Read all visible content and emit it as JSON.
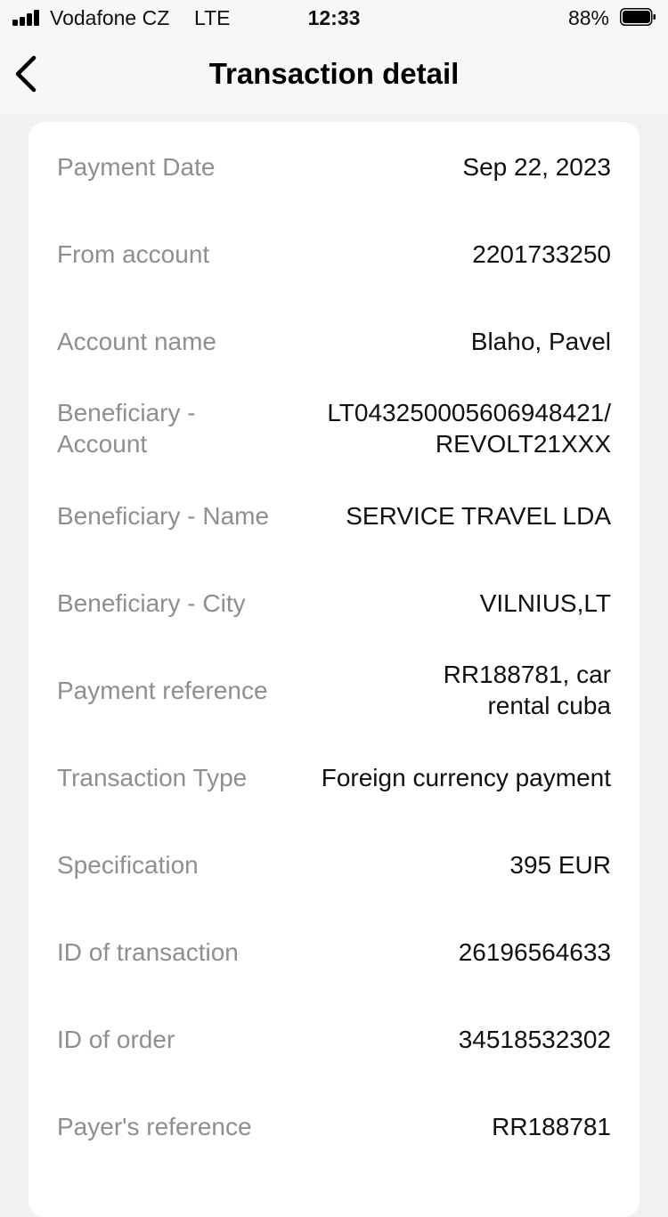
{
  "status_bar": {
    "carrier": "Vodafone CZ",
    "network": "LTE",
    "time": "12:33",
    "battery_percent": "88%",
    "battery_level": 0.88
  },
  "nav": {
    "title": "Transaction detail",
    "back_icon": "chevron-left-icon"
  },
  "details": [
    {
      "label": "Payment Date",
      "value": "Sep 22, 2023"
    },
    {
      "label": "From account",
      "value": "2201733250"
    },
    {
      "label": "Account name",
      "value": "Blaho, Pavel"
    },
    {
      "label": "Beneficiary - Account",
      "value": "LT043250005606948421/ REVOLT21XXX"
    },
    {
      "label": "Beneficiary - Name",
      "value": "SERVICE TRAVEL LDA"
    },
    {
      "label": "Beneficiary - City",
      "value": "VILNIUS,LT"
    },
    {
      "label": "Payment reference",
      "value": "RR188781, car rental cuba"
    },
    {
      "label": "Transaction Type",
      "value": "Foreign currency payment"
    },
    {
      "label": "Specification",
      "value": "395 EUR"
    },
    {
      "label": "ID of transaction",
      "value": "26196564633"
    },
    {
      "label": "ID of order",
      "value": "34518532302"
    },
    {
      "label": "Payer's reference",
      "value": "RR188781"
    }
  ]
}
